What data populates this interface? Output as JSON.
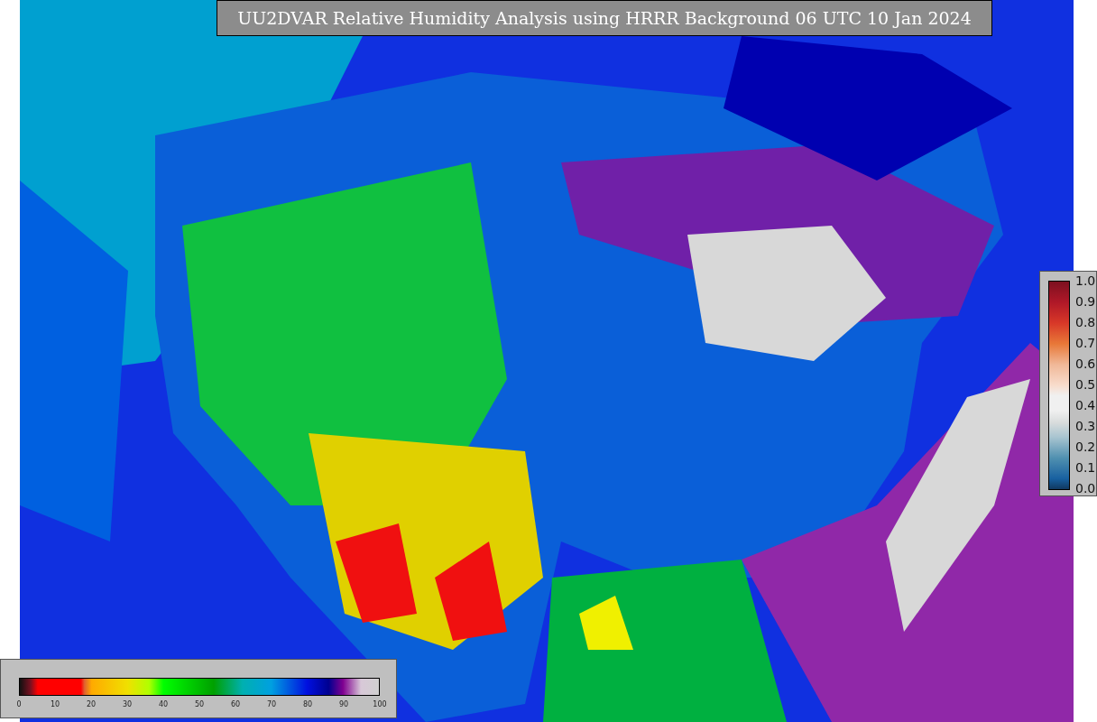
{
  "title": "UU2DVAR Relative Humidity Analysis using HRRR Background 06 UTC 10 Jan 2024",
  "humidity_colorbar": {
    "ticks": [
      "0",
      "10",
      "20",
      "30",
      "40",
      "50",
      "60",
      "70",
      "80",
      "90",
      "100"
    ]
  },
  "station_colorbar": {
    "ticks": [
      "1.0",
      "0.9",
      "0.8",
      "0.7",
      "0.6",
      "0.5",
      "0.4",
      "0.3",
      "0.2",
      "0.1",
      "0.0"
    ]
  }
}
